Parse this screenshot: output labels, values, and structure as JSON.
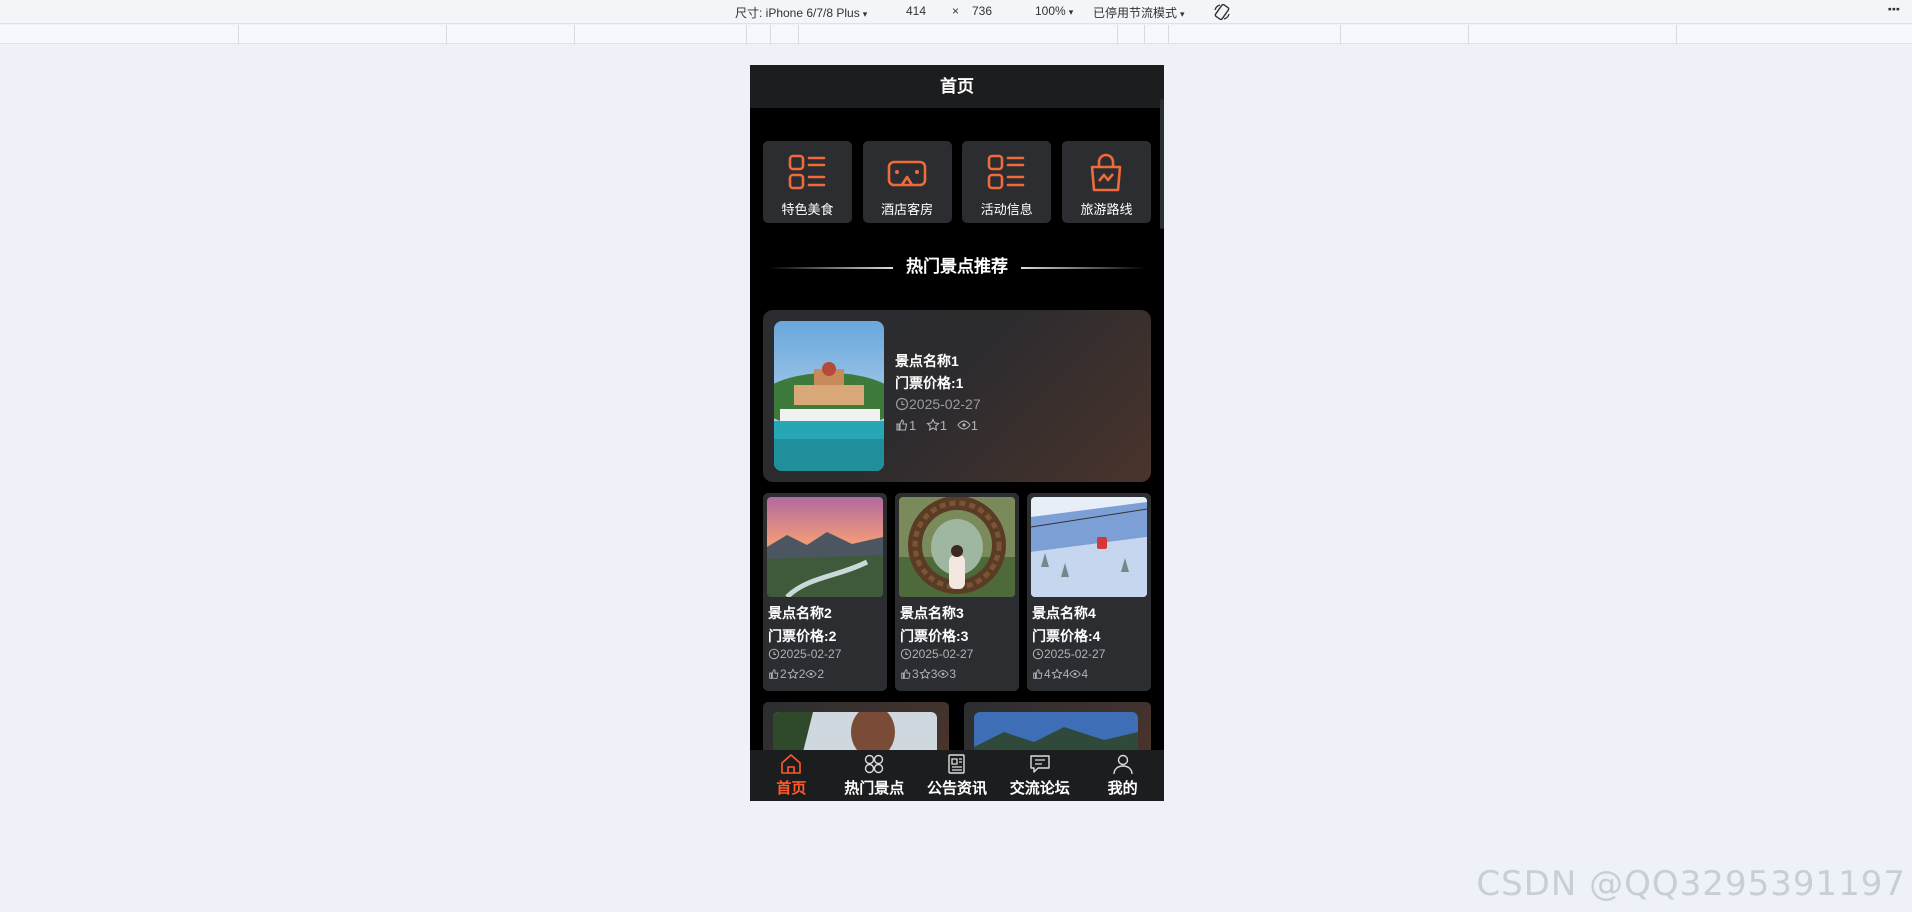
{
  "devtools": {
    "size_label": "尺寸: iPhone 6/7/8 Plus",
    "width": "414",
    "times": "×",
    "height": "736",
    "zoom": "100%",
    "throttle": "已停用节流模式",
    "caret": "▾"
  },
  "page": {
    "title": "首页"
  },
  "nav": [
    {
      "label": "特色美食",
      "icon": "list-icon"
    },
    {
      "label": "酒店客房",
      "icon": "vr-goggles-icon"
    },
    {
      "label": "活动信息",
      "icon": "list-icon"
    },
    {
      "label": "旅游路线",
      "icon": "shopping-bag-icon"
    }
  ],
  "section": {
    "title": "热门景点推荐"
  },
  "featured": {
    "name": "景点名称1",
    "price": "门票价格:1",
    "date": "2025-02-27",
    "likes": "1",
    "favs": "1",
    "views": "1"
  },
  "cards": [
    {
      "name": "景点名称2",
      "price": "门票价格:2",
      "date": "2025-02-27",
      "likes": "2",
      "favs": "2",
      "views": "2"
    },
    {
      "name": "景点名称3",
      "price": "门票价格:3",
      "date": "2025-02-27",
      "likes": "3",
      "favs": "3",
      "views": "3"
    },
    {
      "name": "景点名称4",
      "price": "门票价格:4",
      "date": "2025-02-27",
      "likes": "4",
      "favs": "4",
      "views": "4"
    }
  ],
  "tabs": [
    {
      "label": "首页",
      "icon": "home-icon"
    },
    {
      "label": "热门景点",
      "icon": "clover-icon"
    },
    {
      "label": "公告资讯",
      "icon": "news-icon"
    },
    {
      "label": "交流论坛",
      "icon": "chat-icon"
    },
    {
      "label": "我的",
      "icon": "user-icon"
    }
  ],
  "colors": {
    "accent": "#ff5a2b",
    "icon_orange": "#f06a3a",
    "tile_bg": "#2b2d31",
    "header_bg": "#1c1d1f"
  },
  "watermark": "CSDN @QQ3295391197"
}
